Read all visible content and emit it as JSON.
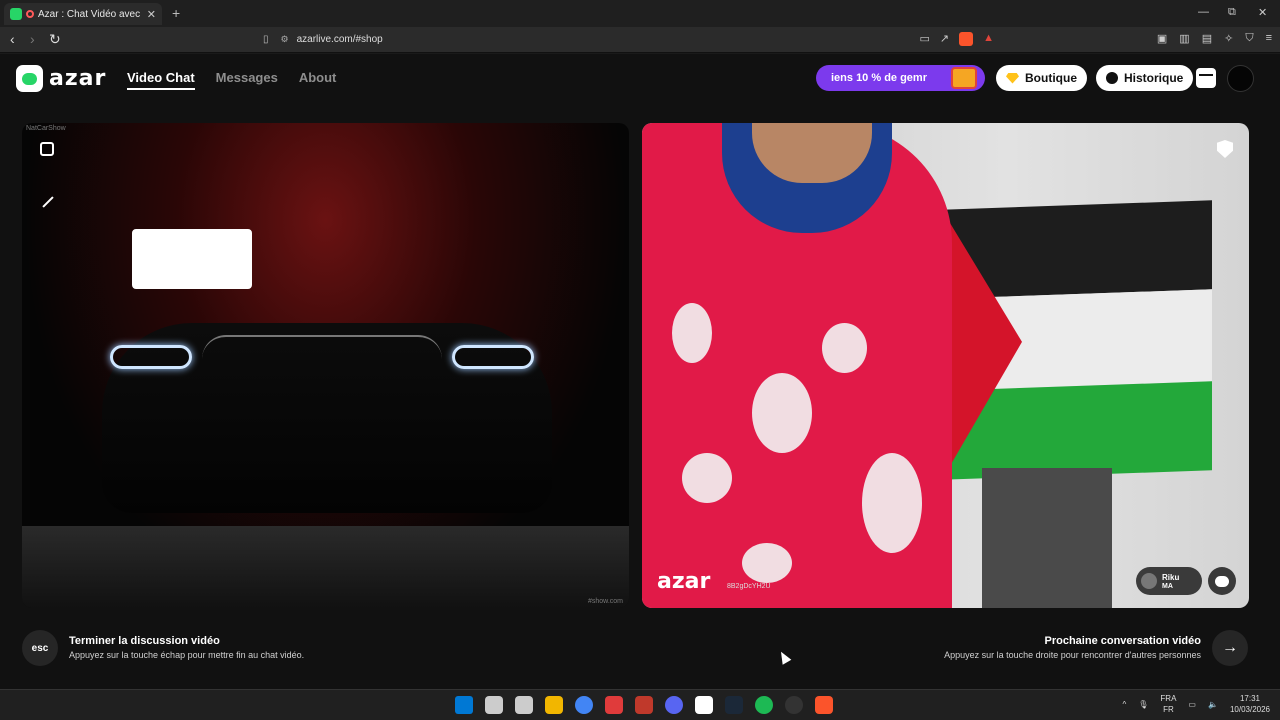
{
  "browser": {
    "tab_title": "Azar : Chat Vidéo avec de no",
    "tab_close": "✕",
    "new_tab": "+",
    "url": "azarlive.com/#shop",
    "window_controls": [
      "—",
      "⧉",
      "✕"
    ]
  },
  "app": {
    "logo_text": "azar",
    "nav": [
      "Video Chat",
      "Messages",
      "About"
    ],
    "promo_text": "iens 10 % de gemr",
    "boutique_label": "Boutique",
    "historique_label": "Historique"
  },
  "video": {
    "left_tag_top": "NatCarShow",
    "left_tag_bottom": "#show.com",
    "watermark": "azar",
    "watermark_id": "8B2gDcYH2U",
    "remote_user": "Riku",
    "remote_country": "MA"
  },
  "hints": {
    "esc_label": "esc",
    "end_title": "Terminer la discussion vidéo",
    "end_sub": "Appuyez sur la touche échap pour mettre fin au chat vidéo.",
    "next_title": "Prochaine conversation vidéo",
    "next_sub": "Appuyez sur la touche droite pour rencontrer d'autres personnes",
    "next_arrow": "→"
  },
  "taskbar": {
    "lang_top": "FRA",
    "lang_bottom": "FR",
    "time": "17:31",
    "date": "10/03/2026",
    "icon_colors": [
      "#0078d4",
      "#cccccc",
      "#cccccc",
      "#f2b600",
      "#4285f4",
      "#e03b3b",
      "#c0392b",
      "#5865f2",
      "#ffffff",
      "#1b2838",
      "#1db954",
      "#333333",
      "#fb542b"
    ]
  }
}
